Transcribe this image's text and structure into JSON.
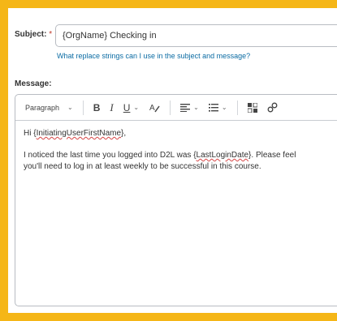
{
  "subject": {
    "label": "Subject:",
    "required_mark": "*",
    "value": "{OrgName} Checking in"
  },
  "help_link": "What replace strings can I use in the subject and message?",
  "message": {
    "label": "Message:",
    "toolbar": {
      "paragraph_label": "Paragraph",
      "bold": "B",
      "italic": "I",
      "underline": "U",
      "icons": [
        "chevron-down-icon",
        "font-format-icon",
        "align-icon",
        "list-icon",
        "insert-stuff-icon",
        "link-icon"
      ]
    },
    "body": {
      "greeting_prefix": "Hi {",
      "greeting_token": "InitiatingUserFirstName",
      "greeting_suffix": "},",
      "line2_prefix": "I noticed the last time you logged into D2L was {",
      "line2_token": "LastLoginDate",
      "line2_suffix": "}. Please feel",
      "line3": "you'll need to log in at least weekly to be successful in this course."
    }
  },
  "colors": {
    "frame": "#f5b617",
    "link": "#0a6ba3",
    "spellcheck": "#d64545"
  }
}
